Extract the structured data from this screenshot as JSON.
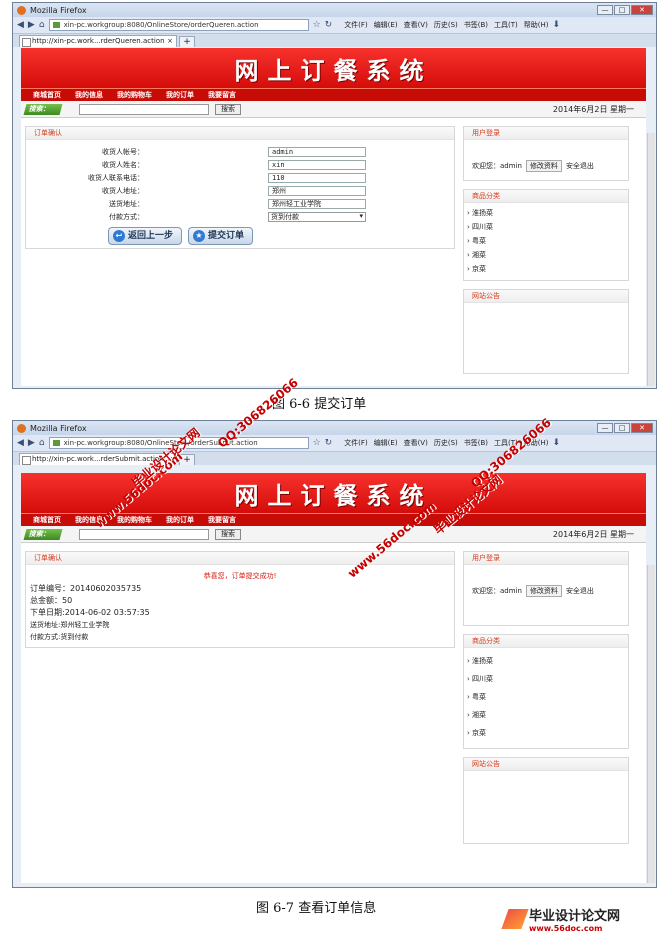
{
  "browser": {
    "title": "Mozilla Firefox",
    "win_min": "—",
    "win_max": "□",
    "win_close": "✕",
    "menus": [
      "文件(F)",
      "编辑(E)",
      "查看(V)",
      "历史(S)",
      "书签(B)",
      "工具(T)",
      "帮助(H)"
    ],
    "shot1": {
      "url": "xin-pc.workgroup:8080/OnlineStore/orderQueren.action",
      "tab": "http://xin-pc.work...rderQueren.action"
    },
    "shot2": {
      "url": "xin-pc.workgroup:8080/OnlineStore/orderSubmit.action",
      "tab": "http://xin-pc.work...rderSubmit.action"
    }
  },
  "site": {
    "title": "网上订餐系统",
    "nav": [
      "商城首页",
      "我的信息",
      "我的购物车",
      "我的订单",
      "我要留言"
    ],
    "search_label": "搜索：",
    "search_button": "搜索",
    "date": "2014年6月2日 星期一"
  },
  "order_confirm": {
    "heading": "订单确认",
    "fields": [
      {
        "label": "收货人帐号：",
        "value": "admin"
      },
      {
        "label": "收货人姓名：",
        "value": "xin"
      },
      {
        "label": "收货人联系电话：",
        "value": "110"
      },
      {
        "label": "收货人地址：",
        "value": "郑州"
      },
      {
        "label": "送货地址：",
        "value": "郑州轻工业学院"
      },
      {
        "label": "付款方式：",
        "value": "货到付款"
      }
    ],
    "back_button": "返回上一步",
    "submit_button": "提交订单"
  },
  "order_result": {
    "heading": "订单确认",
    "success": "恭喜您，订单提交成功!",
    "lines": [
      "订单编号：20140602035735",
      "总金额：50",
      "下单日期:2014-06-02 03:57:35"
    ],
    "small_lines": [
      "送货地址:郑州轻工业学院",
      "付款方式:货到付款"
    ]
  },
  "sidebar": {
    "login_heading": "用户登录",
    "welcome": "欢迎您：admin",
    "edit_button": "修改资料",
    "logout": "安全退出",
    "category_heading": "商品分类",
    "categories": [
      "› 淮扬菜",
      "› 四川菜",
      "› 粤菜",
      "› 湘菜",
      "› 京菜"
    ],
    "notice_heading": "网站公告"
  },
  "captions": {
    "fig1": "图 6-6 提交订单",
    "fig2": "图 6-7 查看订单信息"
  },
  "watermarks": [
    "毕业设计论文网",
    "www.56doc.com",
    "QQ:306826066"
  ],
  "logo": {
    "text": "毕业设计论文网",
    "url": "www.56doc.com"
  }
}
